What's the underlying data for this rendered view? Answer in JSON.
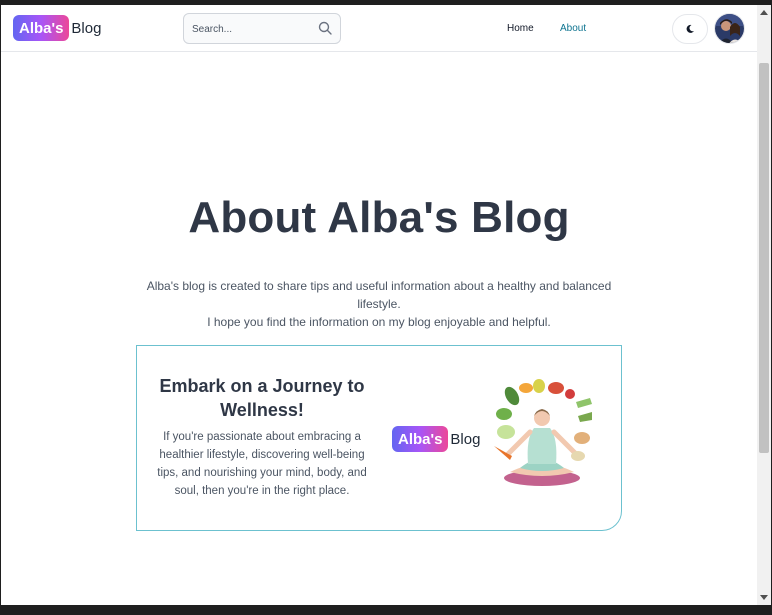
{
  "navbar": {
    "logo_badge": "Alba's",
    "logo_text": "Blog",
    "search_placeholder": "Search...",
    "links": [
      {
        "label": "Home",
        "active": false
      },
      {
        "label": "About",
        "active": true
      }
    ],
    "theme_icon": "moon-icon"
  },
  "main": {
    "title": "About Alba's Blog",
    "intro_line1": "Alba's blog is created to share tips and useful information about a healthy and balanced lifestyle.",
    "intro_line2": "I hope you find the information on my blog enjoyable and helpful.",
    "card": {
      "title": "Embark on a Journey to Wellness!",
      "text": "If you're passionate about embracing a healthier lifestyle, discovering well-being tips, and nourishing your mind, body, and soul, then you're in the right place.",
      "logo_badge": "Alba's",
      "logo_text": "Blog",
      "illustration": "meditation-vegetables-illustration"
    }
  },
  "colors": {
    "accent": "#0e7490",
    "card_border": "#6cc1cf",
    "gradient_start": "#6366f1",
    "gradient_end": "#ec4899"
  }
}
